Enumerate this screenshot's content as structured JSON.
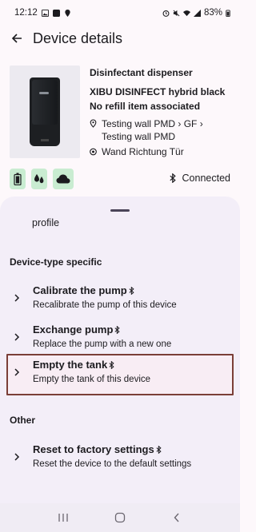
{
  "status_bar": {
    "time": "12:12",
    "battery": "83%"
  },
  "app_bar": {
    "title": "Device details"
  },
  "device": {
    "type": "Disinfectant dispenser",
    "name": "XIBU DISINFECT hybrid black",
    "refill": "No refill item associated",
    "location_line1": "Testing wall PMD › GF ›",
    "location_line2": "Testing wall  PMD",
    "position": "Wand Richtung Tür"
  },
  "status_icons": [
    "battery-icon",
    "drops-icon",
    "cloud-icon"
  ],
  "connection": {
    "label": "Connected"
  },
  "sheet": {
    "cut_text": "profile",
    "device_type_section": "Device-type specific",
    "other_section": "Other",
    "items": [
      {
        "title": "Calibrate the pump",
        "subtitle": "Recalibrate the pump of this device"
      },
      {
        "title": "Exchange pump",
        "subtitle": "Replace the pump with a new one"
      },
      {
        "title": "Empty the tank",
        "subtitle": "Empty the tank of this device"
      },
      {
        "title": "Reset to factory settings",
        "subtitle": "Reset the device to the default settings"
      }
    ]
  },
  "colors": {
    "accent_green": "#c9ecd1",
    "highlight_border": "#7a3e37",
    "sheet_bg": "#f3eef8"
  }
}
